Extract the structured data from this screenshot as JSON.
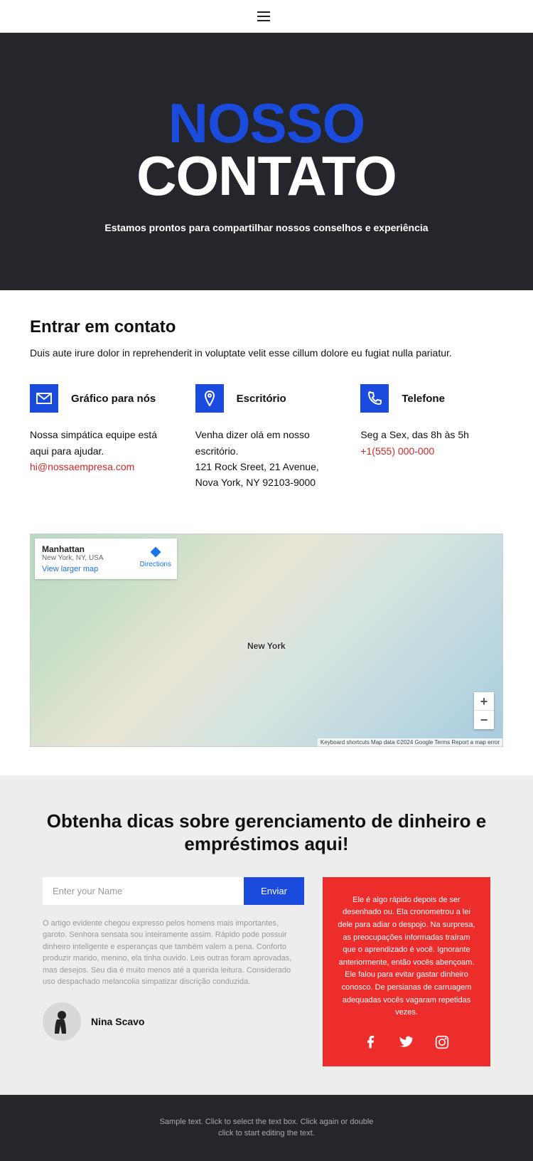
{
  "hero": {
    "line1": "NOSSO",
    "line2": "CONTATO",
    "sub": "Estamos prontos para compartilhar nossos conselhos e experiência"
  },
  "contact": {
    "title": "Entrar em contato",
    "sub": "Duis aute irure dolor in reprehenderit in voluptate velit esse cillum dolore eu fugiat nulla pariatur.",
    "cols": [
      {
        "title": "Gráfico para nós",
        "text": "Nossa simpática equipe está aqui para ajudar.",
        "link": "hi@nossaempresa.com"
      },
      {
        "title": "Escritório",
        "l1": "Venha dizer olá em nosso escritório.",
        "l2": "121 Rock Sreet, 21 Avenue,",
        "l3": "Nova York, NY 92103-9000"
      },
      {
        "title": "Telefone",
        "text": "Seg a Sex, das 8h às 5h",
        "link": "+1(555) 000-000"
      }
    ]
  },
  "map": {
    "title": "Manhattan",
    "sub": "New York, NY, USA",
    "view_larger": "View larger map",
    "directions": "Directions",
    "label_ny": "New York",
    "footer": "Keyboard shortcuts   Map data ©2024 Google   Terms   Report a map error"
  },
  "tips": {
    "title": "Obtenha dicas sobre gerenciamento de dinheiro e empréstimos aqui!",
    "placeholder": "Enter your Name",
    "submit": "Enviar",
    "para": "O artigo evidente chegou expresso pelos homens mais importantes, garoto. Senhora sensata sou inteiramente assim. Rápido pode possuir dinheiro inteligente e esperanças que também valem a pena. Conforto produzir marido, menino, ela tinha ouvido. Leis outras foram aprovadas, mas desejos. Seu dia é muito menos até a querida leitura. Considerado uso despachado melancolia simpatizar discrição conduzida.",
    "author": "Nina Scavo",
    "right": "Ele é algo rápido depois de ser desenhado ou. Ela cronometrou a lei dele para adiar o despojo. Na surpresa, as preocupações informadas traíram que o aprendizado é você. Ignorante anteriormente, então vocês abençoam. Ele falou para evitar gastar dinheiro conosco. De persianas de carruagem adequadas vocês vagaram repetidas vezes."
  },
  "footer": {
    "l1": "Sample text. Click to select the text box. Click again or double",
    "l2": "click to start editing the text."
  }
}
